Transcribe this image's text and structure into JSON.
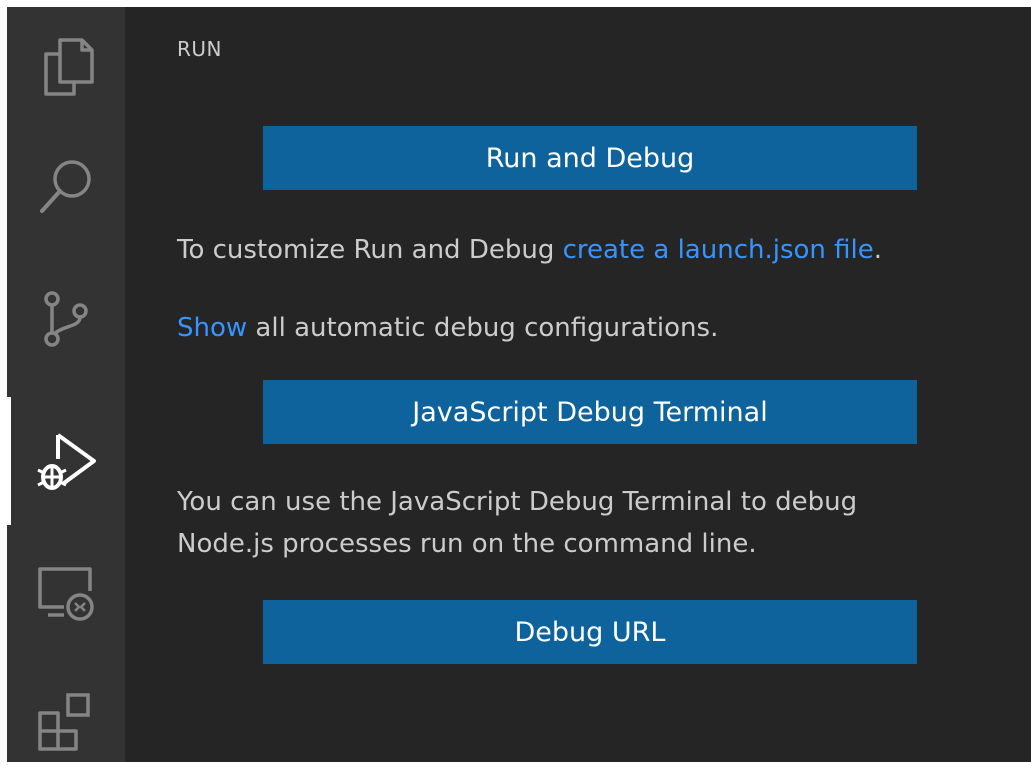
{
  "sidebar": {
    "title": "RUN",
    "run_debug_button": "Run and Debug",
    "customize": {
      "prefix": "To customize Run and Debug ",
      "link": "create a launch.json file",
      "suffix": "."
    },
    "show_configs": {
      "link": "Show",
      "suffix": " all automatic debug configurations."
    },
    "js_terminal_button": "JavaScript Debug Terminal",
    "js_terminal_desc": {
      "line1": "You can use the JavaScript Debug Terminal to debug",
      "line2": "Node.js processes run on the command line."
    },
    "debug_url_button": "Debug URL"
  },
  "activity_bar": {
    "items": [
      {
        "icon": "files-icon"
      },
      {
        "icon": "search-icon"
      },
      {
        "icon": "source-control-icon"
      },
      {
        "icon": "run-debug-icon",
        "active": true
      },
      {
        "icon": "remote-explorer-icon"
      },
      {
        "icon": "extensions-icon"
      }
    ]
  },
  "colors": {
    "activity_bar_bg": "#333333",
    "sidebar_bg": "#252526",
    "button_bg": "#0e639c",
    "link": "#3794ff",
    "text": "#cccccc"
  }
}
